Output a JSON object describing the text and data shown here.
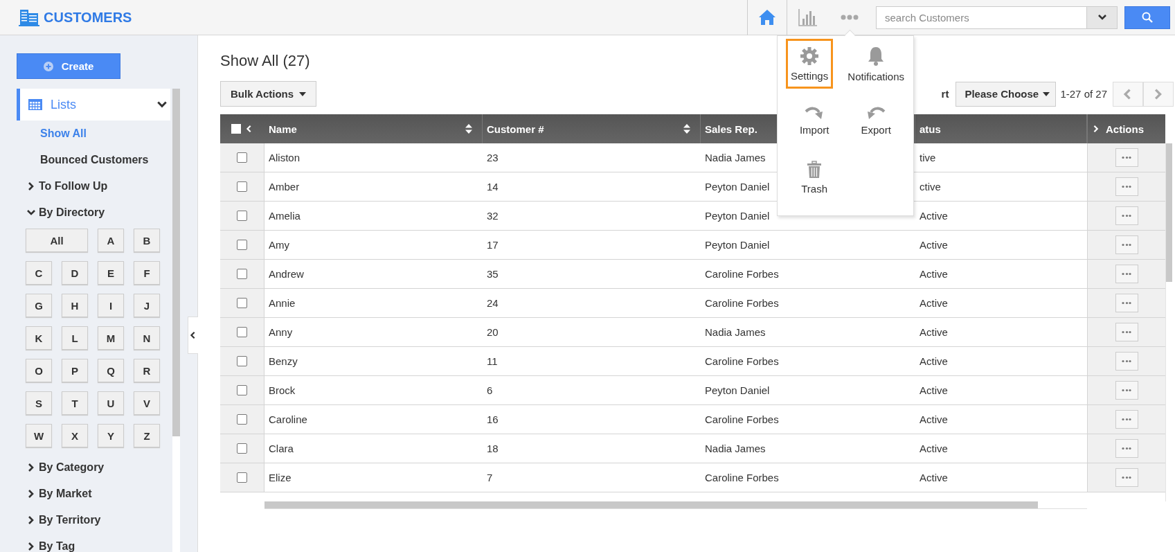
{
  "header": {
    "title": "CUSTOMERS",
    "nav": [
      {
        "kind": "home",
        "selected": true
      },
      {
        "kind": "chart",
        "selected": false
      },
      {
        "kind": "more",
        "selected": false
      }
    ],
    "search": {
      "placeholder": "search Customers"
    }
  },
  "sidebar": {
    "create_button": "Create",
    "section": {
      "label": "Lists",
      "expanded": true,
      "items": [
        {
          "kind": "link",
          "label": "Show All",
          "selected": true
        },
        {
          "kind": "link",
          "label": "Bounced Customers",
          "selected": false
        },
        {
          "kind": "group",
          "label": "To Follow Up",
          "expanded": false
        },
        {
          "kind": "group",
          "label": "By Directory",
          "expanded": true,
          "letters": [
            {
              "label": "All",
              "selected": false
            },
            {
              "label": "A",
              "selected": false
            },
            {
              "label": "B",
              "selected": false
            },
            {
              "label": "C",
              "selected": false
            },
            {
              "label": "D",
              "selected": false
            },
            {
              "label": "E",
              "selected": false
            },
            {
              "label": "F",
              "selected": false
            },
            {
              "label": "G",
              "selected": false
            },
            {
              "label": "H",
              "selected": false
            },
            {
              "label": "I",
              "selected": false
            },
            {
              "label": "J",
              "selected": false
            },
            {
              "label": "K",
              "selected": false
            },
            {
              "label": "L",
              "selected": false
            },
            {
              "label": "M",
              "selected": false
            },
            {
              "label": "N",
              "selected": false
            },
            {
              "label": "O",
              "selected": false
            },
            {
              "label": "P",
              "selected": false
            },
            {
              "label": "Q",
              "selected": false
            },
            {
              "label": "R",
              "selected": false
            },
            {
              "label": "S",
              "selected": false
            },
            {
              "label": "T",
              "selected": false
            },
            {
              "label": "U",
              "selected": false
            },
            {
              "label": "V",
              "selected": false
            },
            {
              "label": "W",
              "selected": false
            },
            {
              "label": "X",
              "selected": false
            },
            {
              "label": "Y",
              "selected": false
            },
            {
              "label": "Z",
              "selected": false
            }
          ]
        },
        {
          "kind": "group",
          "label": "By Category",
          "expanded": false
        },
        {
          "kind": "group",
          "label": "By Market",
          "expanded": false
        },
        {
          "kind": "group",
          "label": "By Territory",
          "expanded": false
        },
        {
          "kind": "group",
          "label": "By Tag",
          "expanded": false
        }
      ]
    }
  },
  "main": {
    "title": "Show All (27)",
    "bulk_actions": "Bulk Actions",
    "sort_label": "rt",
    "sort_select": "Please Choose",
    "pagination": "1-27 of 27",
    "table": {
      "select_all": {
        "checked": false
      },
      "columns": [
        {
          "label": "Name",
          "sortable": true
        },
        {
          "label": "Customer #",
          "sortable": true
        },
        {
          "label": "Sales Rep.",
          "sortable": false
        },
        {
          "label": "atus",
          "sortable": false
        }
      ],
      "actions_label": "Actions",
      "rows": [
        {
          "name": "Aliston",
          "customer_no": "23",
          "sales_rep": "Nadia James",
          "status": "tive",
          "checked": false
        },
        {
          "name": "Amber",
          "customer_no": "14",
          "sales_rep": "Peyton Daniel",
          "status": "ctive",
          "checked": false
        },
        {
          "name": "Amelia",
          "customer_no": "32",
          "sales_rep": "Peyton Daniel",
          "status": "Active",
          "checked": false
        },
        {
          "name": "Amy",
          "customer_no": "17",
          "sales_rep": "Peyton Daniel",
          "status": "Active",
          "checked": false
        },
        {
          "name": "Andrew",
          "customer_no": "35",
          "sales_rep": "Caroline Forbes",
          "status": "Active",
          "checked": false
        },
        {
          "name": "Annie",
          "customer_no": "24",
          "sales_rep": "Caroline Forbes",
          "status": "Active",
          "checked": false
        },
        {
          "name": "Anny",
          "customer_no": "20",
          "sales_rep": "Nadia James",
          "status": "Active",
          "checked": false
        },
        {
          "name": "Benzy",
          "customer_no": "11",
          "sales_rep": "Caroline Forbes",
          "status": "Active",
          "checked": false
        },
        {
          "name": "Brock",
          "customer_no": "6",
          "sales_rep": "Peyton Daniel",
          "status": "Active",
          "checked": false
        },
        {
          "name": "Caroline",
          "customer_no": "16",
          "sales_rep": "Caroline Forbes",
          "status": "Active",
          "checked": false
        },
        {
          "name": "Clara",
          "customer_no": "18",
          "sales_rep": "Nadia James",
          "status": "Active",
          "checked": false
        },
        {
          "name": "Elize",
          "customer_no": "7",
          "sales_rep": "Caroline Forbes",
          "status": "Active",
          "checked": false
        }
      ]
    }
  },
  "menu": {
    "items": [
      {
        "kind": "gear",
        "label": "Settings",
        "selected": true
      },
      {
        "kind": "bell",
        "label": "Notifications",
        "selected": false
      },
      {
        "kind": "import",
        "label": "Import",
        "selected": false
      },
      {
        "kind": "export",
        "label": "Export",
        "selected": false
      },
      {
        "kind": "trash",
        "label": "Trash",
        "selected": false
      }
    ]
  }
}
